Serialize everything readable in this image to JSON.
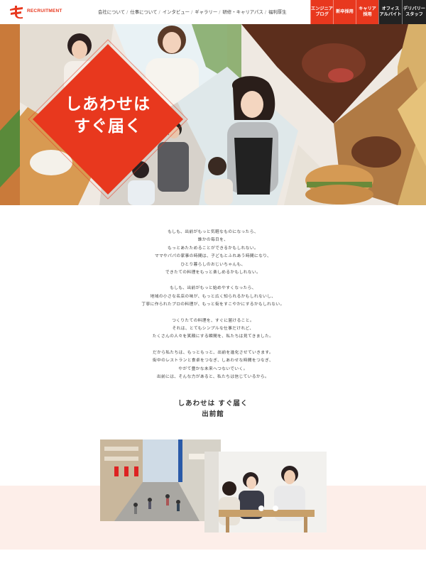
{
  "header": {
    "logo_text": "RECRUITMENT",
    "nav": [
      "会社について",
      "仕事について",
      "インタビュー",
      "ギャラリー",
      "研修・キャリアパス",
      "福利厚生"
    ],
    "nav_separator": "/",
    "tabs": [
      {
        "label": "エンジニア\nブログ",
        "style": "red"
      },
      {
        "label": "新卒採用",
        "style": "red"
      },
      {
        "label": "キャリア\n採用",
        "style": "red"
      },
      {
        "label": "オフィス\nアルバイト",
        "style": "dark"
      },
      {
        "label": "デリバリー\nスタッフ",
        "style": "dark"
      }
    ]
  },
  "hero": {
    "title": "しあわせは\nすぐ届く"
  },
  "intro": {
    "paragraphs": [
      [
        "もしも、出前がもっと気軽なものになったら、",
        "誰かの毎日を、",
        "もっとあたためることができるかもしれない。",
        "ママやパパの家事の時間は、子どもとふれあう時間になり、",
        "ひとり暮らしのおじいちゃんも、",
        "できたての料理をもっと楽しめるかもしれない。"
      ],
      [
        "もしも、出前がもっと始めやすくなったら、",
        "地域の小さな名店の味が、もっと広く知られるかもしれないし、",
        "丁寧に作られたプロの料理が、もっと街をすこやかにするかもしれない。"
      ],
      [
        "つくりたての料理を、すぐに届けること。",
        "それは、とてもシンプルな仕事だけれど、",
        "たくさんの人々を笑顔にする瞬間を、私たちは見てきました。"
      ],
      [
        "だから私たちは、もっともっと、出前を進化させていきます。",
        "街中のレストランと食卓をつなぎ、しあわせな時間をつなぎ、",
        "やがて豊かな未来へつないでいく。",
        "出前には、そんな力があると、私たちは信じているから。"
      ]
    ],
    "slogan": [
      "しあわせは すぐ届く",
      "出前館"
    ]
  },
  "colors": {
    "brand_red": "#e8381e",
    "dark_tab": "#222222",
    "pink_band": "#fdeee9"
  },
  "icons": {
    "logo": "demaekan-logo-mark"
  }
}
